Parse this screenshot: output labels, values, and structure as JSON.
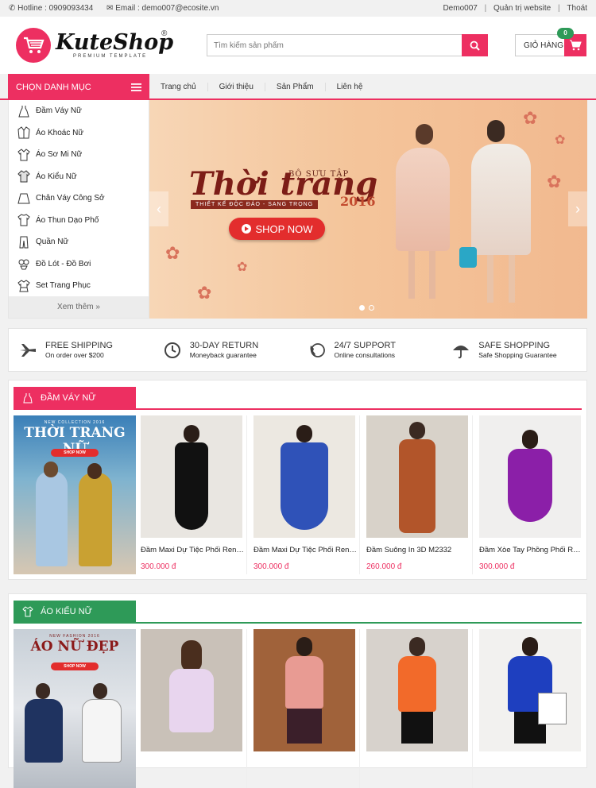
{
  "topbar": {
    "hotline": "Hotline : 0909093434",
    "email": "Email : demo007@ecosite.vn",
    "user": "Demo007",
    "admin": "Quản trị website",
    "logout": "Thoát",
    "sep": "|"
  },
  "logo": {
    "name": "KuteShop",
    "tagline": "PREMIUM TEMPLATE",
    "reg": "®"
  },
  "search": {
    "placeholder": "Tìm kiếm sản phẩm"
  },
  "cart": {
    "label": "GIỎ HÀNG",
    "count": "0"
  },
  "menu": {
    "label": "CHỌN DANH MỤC"
  },
  "nav": [
    "Trang chủ",
    "Giới thiệu",
    "Sản Phẩm",
    "Liên hệ"
  ],
  "categories": [
    {
      "label": "Đầm Váy Nữ",
      "icon": "dress-icon"
    },
    {
      "label": "Áo Khoác Nữ",
      "icon": "jacket-icon"
    },
    {
      "label": "Áo Sơ Mi Nữ",
      "icon": "shirt-icon"
    },
    {
      "label": "Áo Kiểu Nữ",
      "icon": "blouse-icon"
    },
    {
      "label": "Chân Váy Công Sở",
      "icon": "skirt-icon"
    },
    {
      "label": "Áo Thun Dạo Phố",
      "icon": "tshirt-icon"
    },
    {
      "label": "Quần Nữ",
      "icon": "pants-icon"
    },
    {
      "label": "Đồ Lót - Đồ Bơi",
      "icon": "lingerie-icon"
    },
    {
      "label": "Set Trang Phục",
      "icon": "outfit-icon"
    }
  ],
  "more": "Xem thêm »",
  "banner": {
    "sub": "BỘ SƯU TẬP",
    "title": "Thời trang",
    "year": "2016",
    "tag": "THIẾT KẾ ĐỘC ĐÁO - SANG TRỌNG",
    "cta": "SHOP NOW"
  },
  "services": [
    {
      "title": "FREE SHIPPING",
      "sub": "On order over $200",
      "icon": "plane-icon"
    },
    {
      "title": "30-DAY RETURN",
      "sub": "Moneyback guarantee",
      "icon": "clock-icon"
    },
    {
      "title": "24/7 SUPPORT",
      "sub": "Online consultations",
      "icon": "phone-support-icon"
    },
    {
      "title": "SAFE SHOPPING",
      "sub": "Safe Shopping Guarantee",
      "icon": "umbrella-icon"
    }
  ],
  "section1": {
    "title": "ĐẦM VÁY NỮ",
    "color": "#ed2f61",
    "promo": {
      "small": "NEW COLLECTION 2016",
      "title": "THỜI TRANG NỮ",
      "btn": "SHOP NOW"
    },
    "products": [
      {
        "name": "Đầm Maxi Dự Tiệc Phối Ren -...",
        "price": "300.000 đ",
        "dress": "#111111",
        "bg": "#e9e6e1"
      },
      {
        "name": "Đầm Maxi Dự Tiệc Phối Ren -...",
        "price": "300.000 đ",
        "dress": "#2f52b8",
        "bg": "#ece8e1"
      },
      {
        "name": "Đầm Suông In 3D M2332",
        "price": "260.000 đ",
        "dress": "#b2552a",
        "bg": "#d8d2c9"
      },
      {
        "name": "Đầm Xòe Tay Phồng Phối Ren...",
        "price": "300.000 đ",
        "dress": "#8b1fa8",
        "bg": "#f0efee"
      }
    ]
  },
  "section2": {
    "title": "ÁO KIỂU NỮ",
    "color": "#2e9a58",
    "promo": {
      "small": "NEW FASHION 2016",
      "title": "ÁO NỮ ĐẸP",
      "btn": "SHOP NOW"
    },
    "products": [
      {
        "name": "",
        "price": "",
        "dress": "#e8d5ee",
        "bg": "#c9c1b8"
      },
      {
        "name": "",
        "price": "",
        "dress": "#e89b93",
        "bg": "#a0623a"
      },
      {
        "name": "",
        "price": "",
        "dress": "#f26a2a",
        "bg": "#d7d2cc"
      },
      {
        "name": "",
        "price": "",
        "dress": "#1e3fbf",
        "bg": "#f2f1ef"
      }
    ]
  },
  "colors": {
    "accent": "#ed2f61",
    "green": "#2e9a58"
  }
}
